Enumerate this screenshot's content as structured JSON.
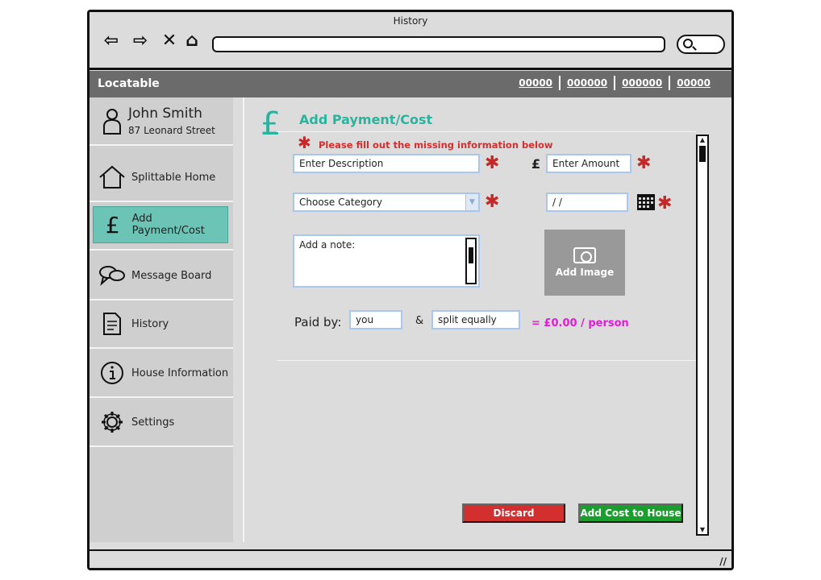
{
  "window": {
    "title": "History"
  },
  "browser": {
    "back_glyph": "⇦",
    "forward_glyph": "⇨",
    "close_glyph": "✕",
    "home_glyph": "⌂"
  },
  "app": {
    "brand": "Locatable",
    "top_links": [
      "00000",
      "000000",
      "000000",
      "00000"
    ]
  },
  "sidebar": {
    "user": {
      "name": "John Smith",
      "address": "87 Leonard Street"
    },
    "items": [
      {
        "label": "Splittable Home",
        "icon": "house-icon"
      },
      {
        "label": "Add Payment/Cost",
        "icon": "pound-icon",
        "active": true
      },
      {
        "label": "Message Board",
        "icon": "speech-bubbles-icon"
      },
      {
        "label": "History",
        "icon": "document-icon"
      },
      {
        "label": "House Information",
        "icon": "info-icon"
      },
      {
        "label": "Settings",
        "icon": "gear-icon"
      }
    ]
  },
  "form": {
    "title": "Add Payment/Cost",
    "title_glyph": "£",
    "warning": "Please fill out the missing information below",
    "description_placeholder": "Enter Description",
    "currency_symbol": "£",
    "amount_placeholder": "Enter Amount",
    "category_placeholder": "Choose Category",
    "date_placeholder": " / /",
    "note_placeholder": "Add a note:",
    "add_image_label": "Add Image",
    "paid_by_label": "Paid by:",
    "paid_by_value": "you",
    "ampersand": "&",
    "split_value": "split equally",
    "per_person": "= £0.00 / person",
    "discard_label": "Discard",
    "submit_label": "Add Cost to House"
  },
  "colors": {
    "accent": "#2bb3a0",
    "required": "#c62828",
    "per_person": "#e619d9",
    "discard": "#d32f2f",
    "submit": "#1a9e2e"
  }
}
